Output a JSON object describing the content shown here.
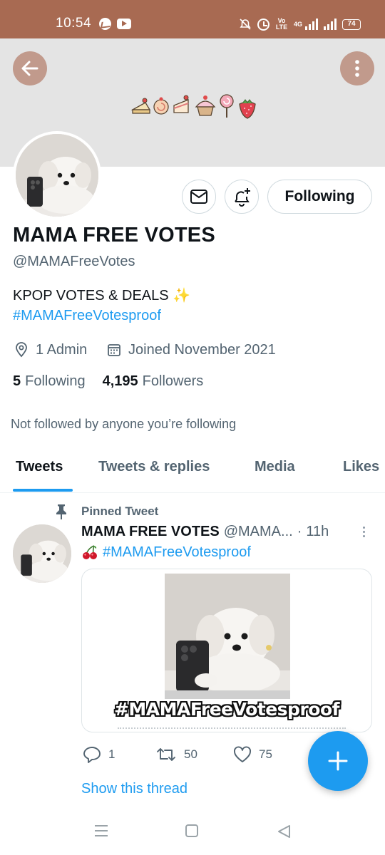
{
  "status_bar": {
    "time": "10:54",
    "network": "4G",
    "volte": "Vo\nLTE",
    "battery": "74"
  },
  "header": {
    "back_icon": "arrow-left-icon",
    "more_icon": "more-vertical-icon",
    "banner_icons": [
      "cake-icon",
      "roll-cake-icon",
      "cake-slice-icon",
      "cupcake-icon",
      "lollipop-icon",
      "strawberry-icon"
    ]
  },
  "profile": {
    "display_name": "MAMA FREE VOTES",
    "handle": "@MAMAFreeVotes",
    "bio": "KPOP VOTES & DEALS ✨",
    "bio_hashtag": "#MAMAFreeVotesproof",
    "location": "1 Admin",
    "joined": "Joined November 2021",
    "following_count": "5",
    "following_label": "Following",
    "followers_count": "4,195",
    "followers_label": "Followers",
    "not_followed_text": "Not followed by anyone you’re following",
    "follow_button_label": "Following"
  },
  "tabs": [
    {
      "label": "Tweets",
      "active": true
    },
    {
      "label": "Tweets & replies",
      "active": false
    },
    {
      "label": "Media",
      "active": false
    },
    {
      "label": "Likes",
      "active": false
    }
  ],
  "tweet": {
    "pinned_label": "Pinned Tweet",
    "author_name": "MAMA FREE VOTES",
    "author_handle": "@MAMA...",
    "separator": "·",
    "time": "11h",
    "text": "#MAMAFreeVotesproof",
    "media_caption": "#MAMAFreeVotesproof",
    "replies": "1",
    "retweets": "50",
    "likes": "75",
    "show_thread": "Show this thread"
  },
  "colors": {
    "status_bar": "#a86a52",
    "banner": "#e4e4e4",
    "header_button": "#c19a8c",
    "accent": "#1d9bf0",
    "text_primary": "#0f1419",
    "text_secondary": "#536471"
  }
}
